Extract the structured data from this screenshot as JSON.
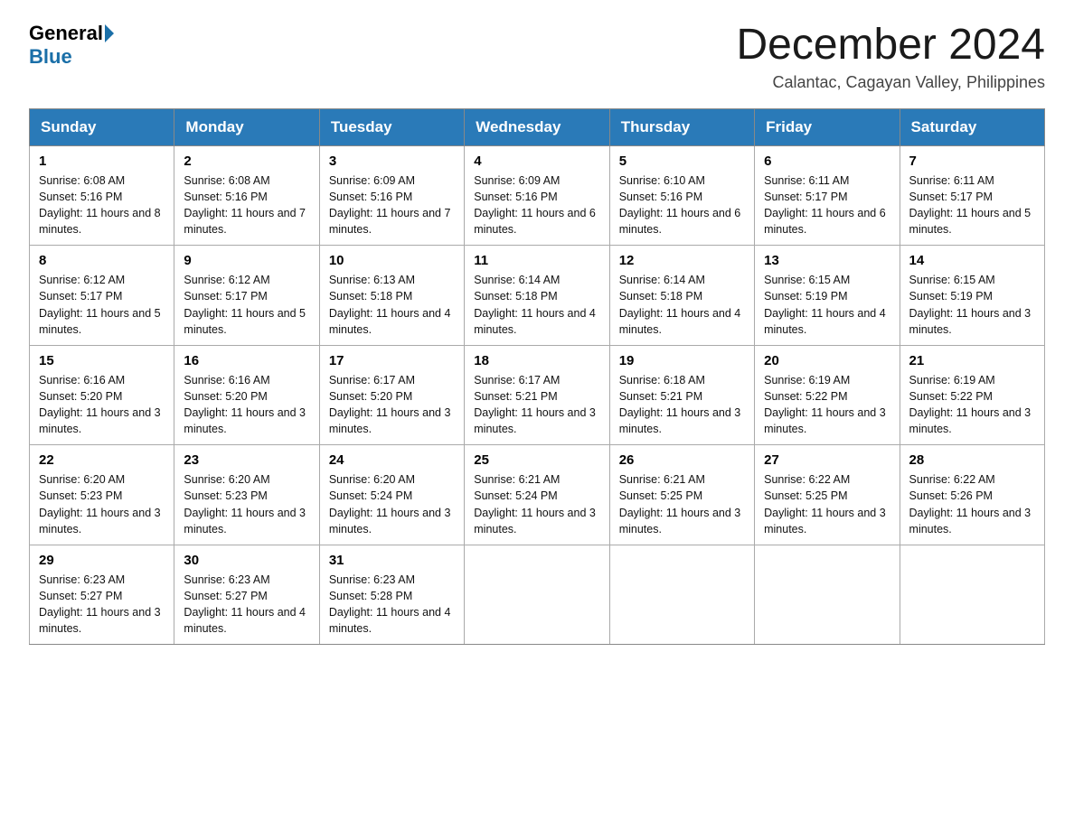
{
  "header": {
    "logo_general": "General",
    "logo_blue": "Blue",
    "month_title": "December 2024",
    "location": "Calantac, Cagayan Valley, Philippines"
  },
  "days_of_week": [
    "Sunday",
    "Monday",
    "Tuesday",
    "Wednesday",
    "Thursday",
    "Friday",
    "Saturday"
  ],
  "weeks": [
    [
      {
        "day": "1",
        "sunrise": "6:08 AM",
        "sunset": "5:16 PM",
        "daylight": "11 hours and 8 minutes."
      },
      {
        "day": "2",
        "sunrise": "6:08 AM",
        "sunset": "5:16 PM",
        "daylight": "11 hours and 7 minutes."
      },
      {
        "day": "3",
        "sunrise": "6:09 AM",
        "sunset": "5:16 PM",
        "daylight": "11 hours and 7 minutes."
      },
      {
        "day": "4",
        "sunrise": "6:09 AM",
        "sunset": "5:16 PM",
        "daylight": "11 hours and 6 minutes."
      },
      {
        "day": "5",
        "sunrise": "6:10 AM",
        "sunset": "5:16 PM",
        "daylight": "11 hours and 6 minutes."
      },
      {
        "day": "6",
        "sunrise": "6:11 AM",
        "sunset": "5:17 PM",
        "daylight": "11 hours and 6 minutes."
      },
      {
        "day": "7",
        "sunrise": "6:11 AM",
        "sunset": "5:17 PM",
        "daylight": "11 hours and 5 minutes."
      }
    ],
    [
      {
        "day": "8",
        "sunrise": "6:12 AM",
        "sunset": "5:17 PM",
        "daylight": "11 hours and 5 minutes."
      },
      {
        "day": "9",
        "sunrise": "6:12 AM",
        "sunset": "5:17 PM",
        "daylight": "11 hours and 5 minutes."
      },
      {
        "day": "10",
        "sunrise": "6:13 AM",
        "sunset": "5:18 PM",
        "daylight": "11 hours and 4 minutes."
      },
      {
        "day": "11",
        "sunrise": "6:14 AM",
        "sunset": "5:18 PM",
        "daylight": "11 hours and 4 minutes."
      },
      {
        "day": "12",
        "sunrise": "6:14 AM",
        "sunset": "5:18 PM",
        "daylight": "11 hours and 4 minutes."
      },
      {
        "day": "13",
        "sunrise": "6:15 AM",
        "sunset": "5:19 PM",
        "daylight": "11 hours and 4 minutes."
      },
      {
        "day": "14",
        "sunrise": "6:15 AM",
        "sunset": "5:19 PM",
        "daylight": "11 hours and 3 minutes."
      }
    ],
    [
      {
        "day": "15",
        "sunrise": "6:16 AM",
        "sunset": "5:20 PM",
        "daylight": "11 hours and 3 minutes."
      },
      {
        "day": "16",
        "sunrise": "6:16 AM",
        "sunset": "5:20 PM",
        "daylight": "11 hours and 3 minutes."
      },
      {
        "day": "17",
        "sunrise": "6:17 AM",
        "sunset": "5:20 PM",
        "daylight": "11 hours and 3 minutes."
      },
      {
        "day": "18",
        "sunrise": "6:17 AM",
        "sunset": "5:21 PM",
        "daylight": "11 hours and 3 minutes."
      },
      {
        "day": "19",
        "sunrise": "6:18 AM",
        "sunset": "5:21 PM",
        "daylight": "11 hours and 3 minutes."
      },
      {
        "day": "20",
        "sunrise": "6:19 AM",
        "sunset": "5:22 PM",
        "daylight": "11 hours and 3 minutes."
      },
      {
        "day": "21",
        "sunrise": "6:19 AM",
        "sunset": "5:22 PM",
        "daylight": "11 hours and 3 minutes."
      }
    ],
    [
      {
        "day": "22",
        "sunrise": "6:20 AM",
        "sunset": "5:23 PM",
        "daylight": "11 hours and 3 minutes."
      },
      {
        "day": "23",
        "sunrise": "6:20 AM",
        "sunset": "5:23 PM",
        "daylight": "11 hours and 3 minutes."
      },
      {
        "day": "24",
        "sunrise": "6:20 AM",
        "sunset": "5:24 PM",
        "daylight": "11 hours and 3 minutes."
      },
      {
        "day": "25",
        "sunrise": "6:21 AM",
        "sunset": "5:24 PM",
        "daylight": "11 hours and 3 minutes."
      },
      {
        "day": "26",
        "sunrise": "6:21 AM",
        "sunset": "5:25 PM",
        "daylight": "11 hours and 3 minutes."
      },
      {
        "day": "27",
        "sunrise": "6:22 AM",
        "sunset": "5:25 PM",
        "daylight": "11 hours and 3 minutes."
      },
      {
        "day": "28",
        "sunrise": "6:22 AM",
        "sunset": "5:26 PM",
        "daylight": "11 hours and 3 minutes."
      }
    ],
    [
      {
        "day": "29",
        "sunrise": "6:23 AM",
        "sunset": "5:27 PM",
        "daylight": "11 hours and 3 minutes."
      },
      {
        "day": "30",
        "sunrise": "6:23 AM",
        "sunset": "5:27 PM",
        "daylight": "11 hours and 4 minutes."
      },
      {
        "day": "31",
        "sunrise": "6:23 AM",
        "sunset": "5:28 PM",
        "daylight": "11 hours and 4 minutes."
      },
      null,
      null,
      null,
      null
    ]
  ]
}
